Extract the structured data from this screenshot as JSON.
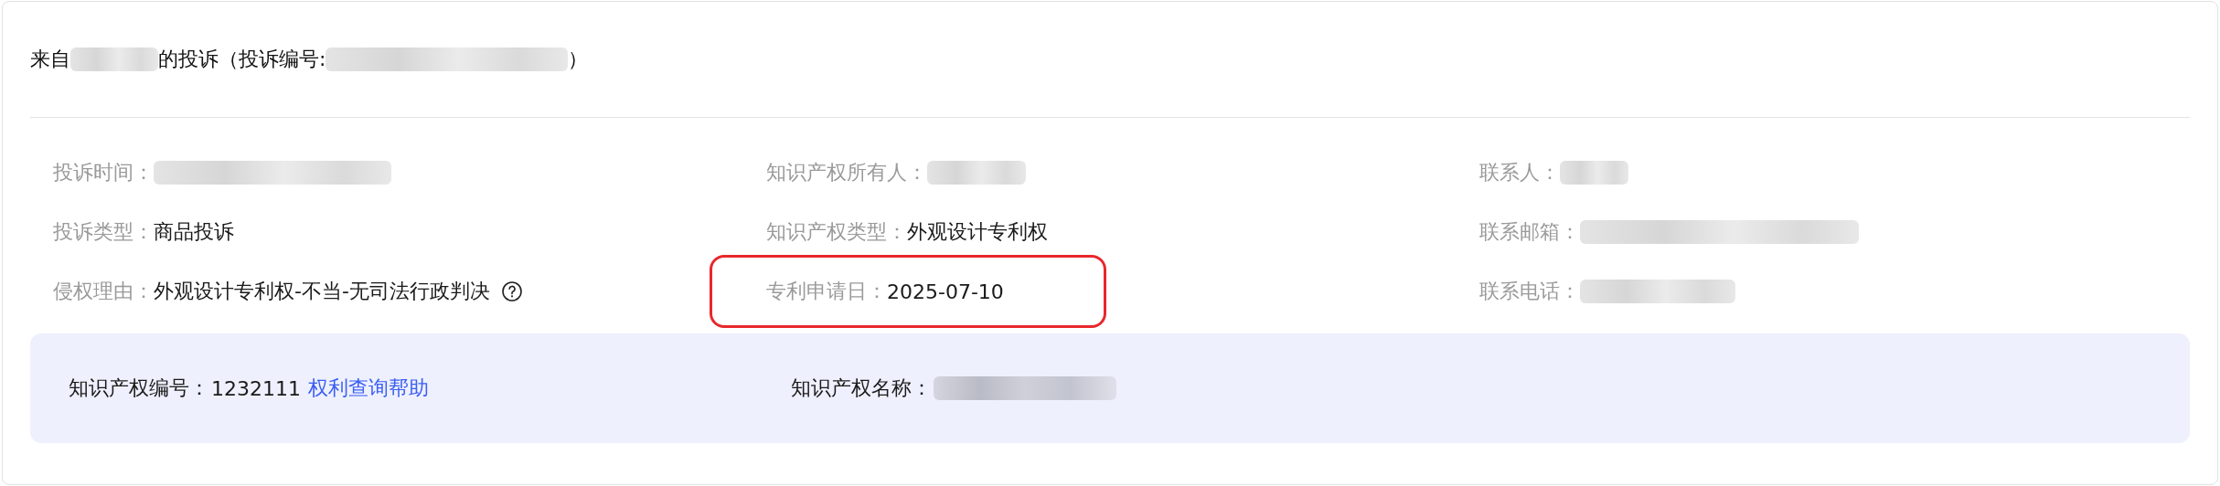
{
  "title": [
    {
      "kind": "text",
      "text": "来自"
    },
    {
      "kind": "redacted"
    },
    {
      "kind": "text",
      "text": "的投诉（投诉编号:"
    },
    {
      "kind": "redacted"
    },
    {
      "kind": "text",
      "text": "）"
    }
  ],
  "details": [
    {
      "label": "投诉时间：",
      "kind": "redacted",
      "highlighted": false
    },
    {
      "label": "知识产权所有人：",
      "kind": "redacted",
      "highlighted": false
    },
    {
      "label": "联系人：",
      "kind": "redacted",
      "highlighted": false
    },
    {
      "label": "投诉类型：",
      "kind": "text",
      "value": "商品投诉",
      "highlighted": false
    },
    {
      "label": "知识产权类型：",
      "kind": "text",
      "value": "外观设计专利权",
      "highlighted": false
    },
    {
      "label": "联系邮箱：",
      "kind": "redacted",
      "highlighted": false
    },
    {
      "label": "侵权理由：",
      "kind": "text",
      "value": "外观设计专利权-不当-无司法行政判决",
      "help": true,
      "highlighted": false
    },
    {
      "label": "专利申请日：",
      "kind": "text",
      "value": "2025-07-10",
      "highlighted": true
    },
    {
      "label": "联系电话：",
      "kind": "redacted",
      "highlighted": false
    }
  ],
  "ip_panel": {
    "fields": [
      {
        "label": "知识产权编号：",
        "kind": "text",
        "value": "1232111",
        "link": "权利查询帮助"
      },
      {
        "label": "知识产权名称：",
        "kind": "redacted"
      }
    ]
  }
}
